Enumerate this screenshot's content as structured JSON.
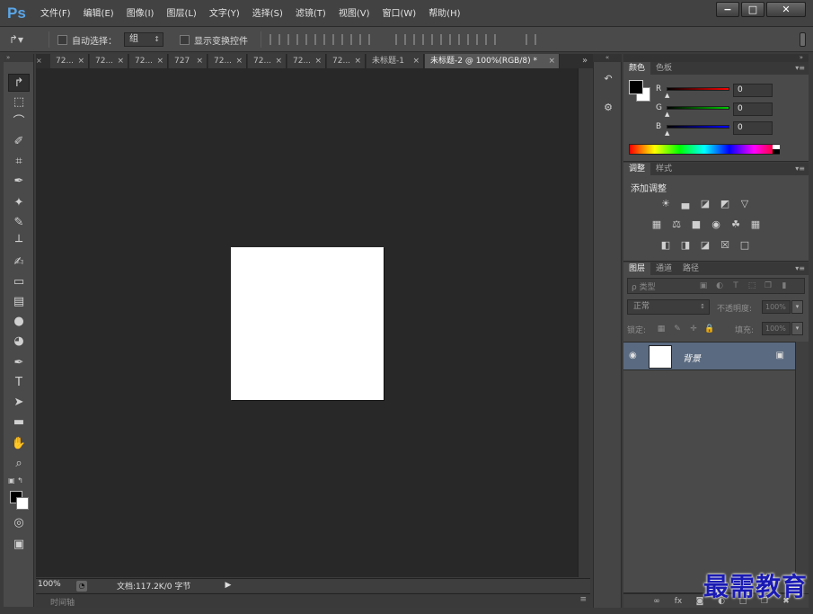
{
  "app": {
    "logo": "Ps"
  },
  "menu": [
    "文件(F)",
    "编辑(E)",
    "图像(I)",
    "图层(L)",
    "文字(Y)",
    "选择(S)",
    "滤镜(T)",
    "视图(V)",
    "窗口(W)",
    "帮助(H)"
  ],
  "window_controls": {
    "minimize": "−",
    "maximize": "□",
    "close": "✕"
  },
  "options": {
    "auto_select_label": "自动选择：",
    "auto_select_value": "组",
    "show_transform_label": "显示变换控件"
  },
  "tabs": [
    {
      "label": "72...",
      "close": "×"
    },
    {
      "label": "72...",
      "close": "×"
    },
    {
      "label": "72...",
      "close": "×"
    },
    {
      "label": "727",
      "close": "×"
    },
    {
      "label": "72...",
      "close": "×"
    },
    {
      "label": "72...",
      "close": "×"
    },
    {
      "label": "72...",
      "close": "×"
    },
    {
      "label": "72...",
      "close": "×"
    },
    {
      "label": "未标题-1",
      "close": "×"
    },
    {
      "label": "未标题-2 @ 100%(RGB/8) *",
      "close": "×"
    }
  ],
  "tab_overflow": "»",
  "tools": [
    {
      "name": "move-tool",
      "glyph": "↱"
    },
    {
      "name": "marquee-tool",
      "glyph": "⬚"
    },
    {
      "name": "lasso-tool",
      "glyph": "⌒"
    },
    {
      "name": "quick-select-tool",
      "glyph": "✐"
    },
    {
      "name": "crop-tool",
      "glyph": "⌗"
    },
    {
      "name": "eyedropper-tool",
      "glyph": "✒"
    },
    {
      "name": "healing-brush-tool",
      "glyph": "✦"
    },
    {
      "name": "brush-tool",
      "glyph": "✎"
    },
    {
      "name": "clone-stamp-tool",
      "glyph": "┴"
    },
    {
      "name": "history-brush-tool",
      "glyph": "✍"
    },
    {
      "name": "eraser-tool",
      "glyph": "▭"
    },
    {
      "name": "gradient-tool",
      "glyph": "▤"
    },
    {
      "name": "blur-tool",
      "glyph": "●"
    },
    {
      "name": "dodge-tool",
      "glyph": "◕"
    },
    {
      "name": "pen-tool",
      "glyph": "✒"
    },
    {
      "name": "type-tool",
      "glyph": "T"
    },
    {
      "name": "path-select-tool",
      "glyph": "➤"
    },
    {
      "name": "rectangle-tool",
      "glyph": "▬"
    },
    {
      "name": "hand-tool",
      "glyph": "✋"
    },
    {
      "name": "zoom-tool",
      "glyph": "⌕"
    }
  ],
  "canvas": {
    "zoom": "100%",
    "doc_info": "文档:117.2K/0 字节"
  },
  "timeline": {
    "label": "时间轴",
    "menu": "≡"
  },
  "color_panel": {
    "tabs": [
      "颜色",
      "色板"
    ],
    "channels": [
      {
        "label": "R",
        "value": "0",
        "color": "#ff0000"
      },
      {
        "label": "G",
        "value": "0",
        "color": "#00cc00"
      },
      {
        "label": "B",
        "value": "0",
        "color": "#0000ff"
      }
    ]
  },
  "adjustments_panel": {
    "tabs": [
      "调整",
      "样式"
    ],
    "title": "添加调整",
    "row1": [
      "☀",
      "▄",
      "◪",
      "◩",
      "▽"
    ],
    "row2": [
      "▦",
      "⚖",
      "■",
      "◉",
      "☘",
      "▦"
    ],
    "row3": [
      "◧",
      "◨",
      "◪",
      "☒",
      "□"
    ]
  },
  "layers_panel": {
    "tabs": [
      "图层",
      "通道",
      "路径"
    ],
    "filter_kind": "ρ 类型",
    "blend_mode": "正常",
    "opacity_label": "不透明度:",
    "opacity_value": "100%",
    "lock_label": "锁定:",
    "fill_label": "填充:",
    "fill_value": "100%",
    "layers": [
      {
        "name": "背景",
        "visible": "◉"
      }
    ]
  },
  "watermark": "最需教育",
  "colors": {
    "foreground": "#000000",
    "background": "#ffffff",
    "accent": "#5aa6e8"
  }
}
